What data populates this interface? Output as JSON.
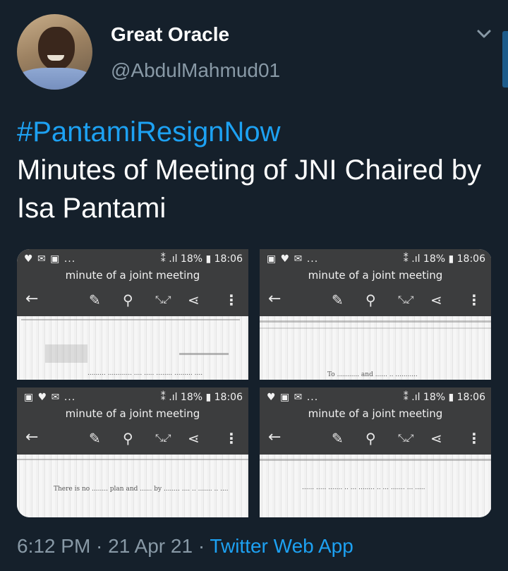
{
  "user": {
    "display_name": "Great Oracle",
    "handle": "@AbdulMahmud01"
  },
  "tweet": {
    "hashtag": "#PantamiResignNow",
    "body": "Minutes of Meeting of JNI Chaired by Isa Pantami"
  },
  "media": [
    {
      "status_left": "♥ ✉ ▣ ...",
      "status_right": "⁑ .ıl 18% ▮ 18:06",
      "title": "minute of a joint meeting",
      "page_text": "......... ............ .... ..... ........ ......... ...."
    },
    {
      "status_left": "▣ ♥ ✉ ...",
      "status_right": "⁑ .ıl 18% ▮ 18:06",
      "title": "minute of a joint meeting",
      "page_text": "To ........... and ...... .. ..........."
    },
    {
      "status_left": "▣ ♥ ✉ ...",
      "status_right": "⁑ .ıl 18% ▮ 18:06",
      "title": "minute of a joint meeting",
      "page_text": "There is no ........ plan and ...... by ........ .... .. ....... .. ...."
    },
    {
      "status_left": "♥ ▣ ✉ ...",
      "status_right": "⁑ .ıl 18% ▮ 18:06",
      "title": "minute of a joint meeting",
      "page_text": "...... ..... ....... .. ... ........ .. ... ....... ... ....."
    }
  ],
  "toolbar_icons": [
    "back-arrow-icon",
    "edit-icon",
    "search-icon",
    "expand-icon",
    "share-icon",
    "more-icon"
  ],
  "meta": {
    "time_date": "6:12 PM · 21 Apr 21 · ",
    "source": "Twitter Web App"
  },
  "colors": {
    "background": "#15202b",
    "accent": "#1da1f2",
    "secondary_text": "#8899a6"
  }
}
